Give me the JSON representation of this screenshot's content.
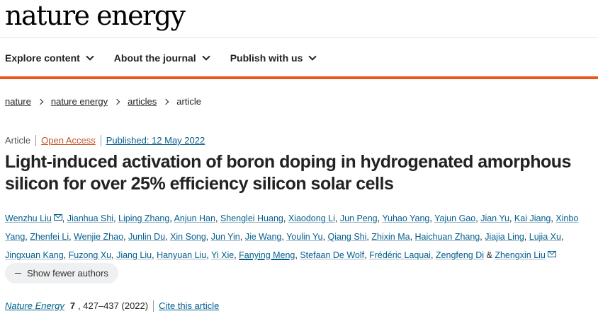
{
  "brand": "nature energy",
  "nav": [
    "Explore content",
    "About the journal",
    "Publish with us"
  ],
  "breadcrumb": [
    "nature",
    "nature energy",
    "articles",
    "article"
  ],
  "meta": {
    "type": "Article",
    "open_access": "Open Access",
    "published": "Published: 12 May 2022"
  },
  "title": "Light-induced activation of boron doping in hydrogenated amorphous silicon for over 25% efficiency silicon solar cells",
  "authors": {
    "list": [
      "Wenzhu Liu",
      "Jianhua Shi",
      "Liping Zhang",
      "Anjun Han",
      "Shenglei Huang",
      "Xiaodong Li",
      "Jun Peng",
      "Yuhao Yang",
      "Yajun Gao",
      "Jian Yu",
      "Kai Jiang",
      "Xinbo Yang",
      "Zhenfei Li",
      "Wenjie Zhao",
      "Junlin Du",
      "Xin Song",
      "Jun Yin",
      "Jie Wang",
      "Youlin Yu",
      "Qiang Shi",
      "Zhixin Ma",
      "Haichuan Zhang",
      "Jiajia Ling",
      "Lujia Xu",
      "Jingxuan Kang",
      "Fuzong Xu",
      "Jiang Liu",
      "Hanyuan Liu",
      "Yi Xie",
      "Fanying Meng",
      "Stefaan De Wolf",
      "Frédéric Laquai",
      "Zengfeng Di",
      "Zhengxin Liu"
    ],
    "and": "&"
  },
  "show_fewer": "Show fewer authors",
  "citation": {
    "journal": "Nature Energy",
    "volume": "7",
    "pages": ", 427–437 (2022)",
    "cite_link": "Cite this article"
  }
}
